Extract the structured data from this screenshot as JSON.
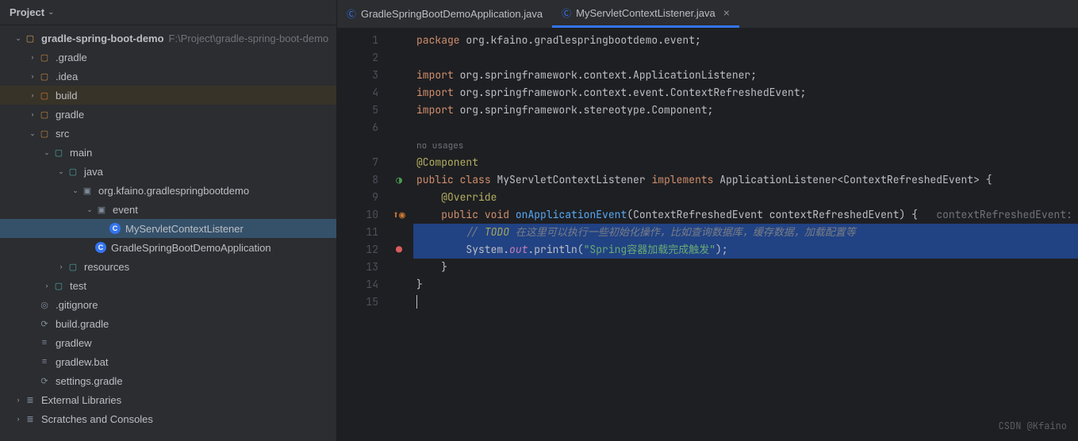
{
  "sidebar": {
    "title": "Project",
    "root": {
      "name": "gradle-spring-boot-demo",
      "path": "F:\\Project\\gradle-spring-boot-demo"
    },
    "nodes": [
      {
        "name": ".gradle"
      },
      {
        "name": ".idea"
      },
      {
        "name": "build"
      },
      {
        "name": "gradle"
      },
      {
        "name": "src"
      },
      {
        "name": "main"
      },
      {
        "name": "java"
      },
      {
        "name": "org.kfaino.gradlespringbootdemo"
      },
      {
        "name": "event"
      },
      {
        "name": "MyServletContextListener"
      },
      {
        "name": "GradleSpringBootDemoApplication"
      },
      {
        "name": "resources"
      },
      {
        "name": "test"
      },
      {
        "name": ".gitignore"
      },
      {
        "name": "build.gradle"
      },
      {
        "name": "gradlew"
      },
      {
        "name": "gradlew.bat"
      },
      {
        "name": "settings.gradle"
      }
    ],
    "external": "External Libraries",
    "scratches": "Scratches and Consoles"
  },
  "tabs": [
    {
      "label": "GradleSpringBootDemoApplication.java"
    },
    {
      "label": "MyServletContextListener.java"
    }
  ],
  "code": {
    "usages": "no usages",
    "package_kw": "package",
    "package_name": " org.kfaino.gradlespringbootdemo.event",
    "import_kw": "import",
    "import1": " org.springframework.context.ApplicationListener",
    "import2": " org.springframework.context.event.ContextRefreshedEvent",
    "import3": " org.springframework.stereotype.",
    "component_cls": "Component",
    "annotation": "@Component",
    "public_kw": "public",
    "class_kw": "class",
    "class_name": "MyServletContextListener",
    "implements_kw": "implements",
    "iface": "ApplicationListener<ContextRefreshedEvent>",
    "override": "@Override",
    "void_kw": "void",
    "method": "onApplicationEvent",
    "param_type": "ContextRefreshedEvent",
    "param_name": "contextRefreshedEvent",
    "hint": "contextRefreshedEvent:",
    "todo_prefix": "// ",
    "todo_kw": "TODO",
    "todo_text": " 在这里可以执行一些初始化操作，比如查询数据库，缓存数据，加载配置等",
    "println_owner": "System.",
    "println_out": "out",
    "println_call": ".println(",
    "println_str": "\"Spring容器加载完成触发\"",
    "println_end": ");",
    "brace_close": "}"
  },
  "lines": [
    "1",
    "2",
    "3",
    "4",
    "5",
    "6",
    "",
    "7",
    "8",
    "9",
    "10",
    "11",
    "12",
    "13",
    "14",
    "15"
  ],
  "watermark": "CSDN @Kfaino"
}
